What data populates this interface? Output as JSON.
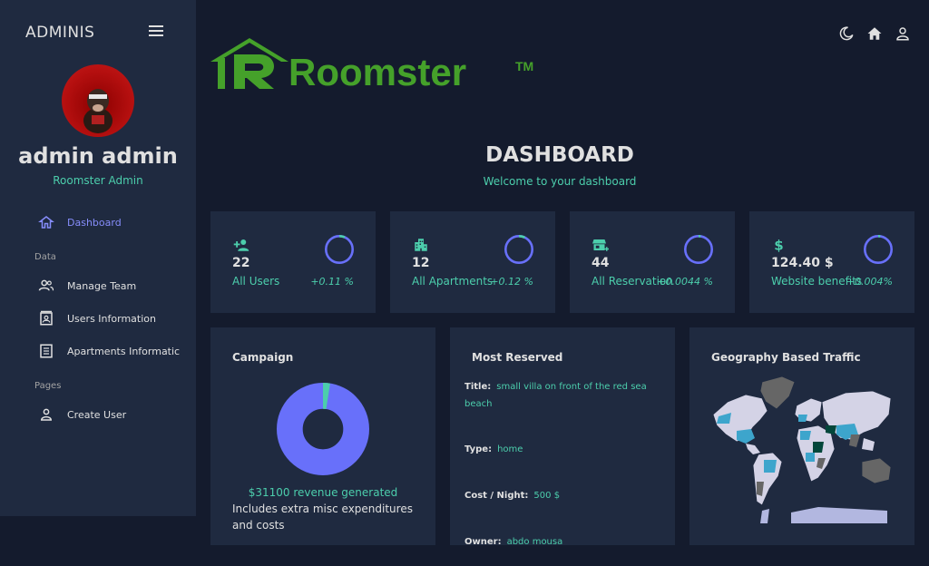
{
  "sidebar": {
    "brand": "ADMINIS",
    "user_name": "admin admin",
    "user_role": "Roomster Admin",
    "items": [
      {
        "label": "Dashboard",
        "icon": "home-outline-icon",
        "active": true
      },
      {
        "label": "Manage Team",
        "icon": "people-icon"
      },
      {
        "label": "Users Information",
        "icon": "contacts-icon"
      },
      {
        "label": "Apartments Informatic",
        "icon": "receipt-icon"
      },
      {
        "label": "Create User",
        "icon": "person-icon"
      }
    ],
    "sections": [
      "Data",
      "Pages"
    ]
  },
  "topbar": {
    "icons": [
      "dark-mode-icon",
      "home-icon",
      "person-icon"
    ]
  },
  "logo": {
    "text": "Roomster",
    "tm": "TM"
  },
  "header": {
    "title": "DASHBOARD",
    "subtitle": "Welcome to your dashboard"
  },
  "stats": [
    {
      "value": "22",
      "label": "All Users",
      "increase": "+0.11 %",
      "progress": 0.11,
      "icon": "person-add-icon"
    },
    {
      "value": "12",
      "label": "All Apartments",
      "increase": "+0.12 %",
      "progress": 0.12,
      "icon": "apartment-icon"
    },
    {
      "value": "44",
      "label": "All Reservation",
      "increase": "+0.0044 %",
      "progress": 0.0044,
      "icon": "store-add-icon"
    },
    {
      "value": "124.40 $",
      "label": "Website benefits",
      "increase": "+0.004%",
      "progress": 0.004,
      "icon": "dollar-icon"
    }
  ],
  "campaign": {
    "title": "Campaign",
    "revenue": "$31100 revenue generated",
    "note": "Includes extra misc expenditures and costs",
    "progress": 0.03
  },
  "most_reserved": {
    "title": "Most Reserved",
    "rows": [
      {
        "key": "Title:",
        "value": "small villa on front of the red sea beach"
      },
      {
        "key": "Type:",
        "value": "home"
      },
      {
        "key": "Cost / Night:",
        "value": "500 $"
      },
      {
        "key": "Owner:",
        "value": "abdo mousa"
      }
    ]
  },
  "geography": {
    "title": "Geography Based Traffic"
  },
  "colors": {
    "accent": "#4cceac",
    "primary_ring": "#6870fa",
    "panel": "#1f2a40",
    "background": "#141b2d",
    "logo_green": "#45a12a"
  }
}
